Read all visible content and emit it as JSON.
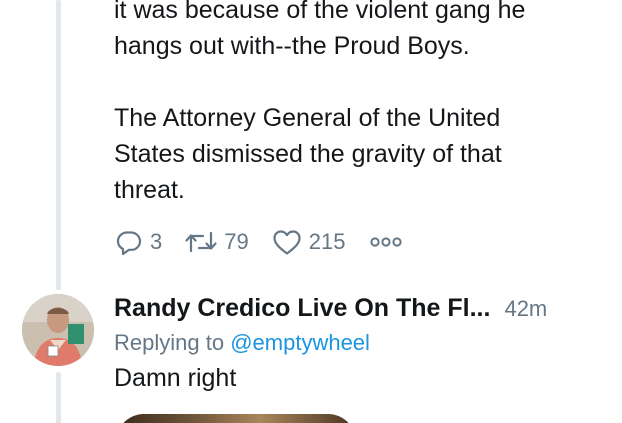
{
  "tweet": {
    "lines_para1": "it was because of the violent gang he\nhangs out with--the Proud Boys.",
    "lines_para2": "The Attorney General of the United\nStates dismissed the gravity of that\nthreat.",
    "actions": {
      "reply_count": "3",
      "retweet_count": "79",
      "like_count": "215"
    },
    "icons": [
      "reply-icon",
      "retweet-icon",
      "like-icon",
      "more-icon"
    ]
  },
  "reply": {
    "author": "Randy Credico Live On The Fl...",
    "time": "42m",
    "replying_prefix": "Replying to",
    "replying_handle": "@emptywheel",
    "text": "Damn right"
  },
  "colors": {
    "text": "#14171a",
    "secondary": "#657786",
    "link": "#1b95e0",
    "thread_line": "#e1e8ed"
  }
}
